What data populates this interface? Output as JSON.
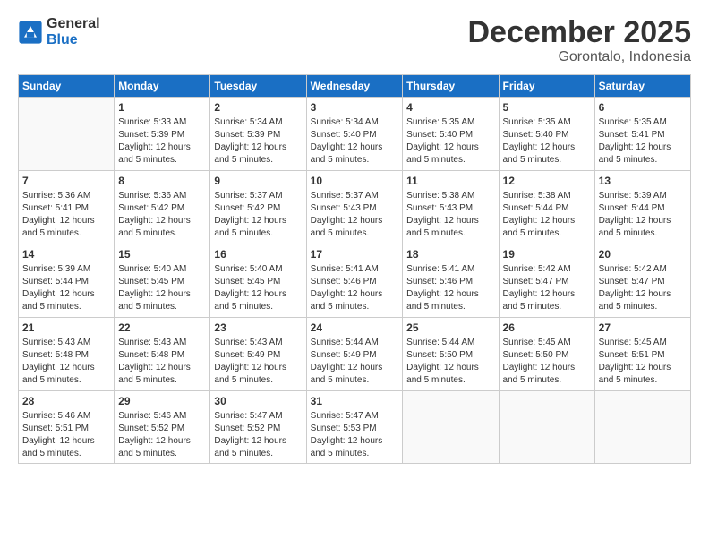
{
  "logo": {
    "text_general": "General",
    "text_blue": "Blue"
  },
  "title": "December 2025",
  "subtitle": "Gorontalo, Indonesia",
  "days_of_week": [
    "Sunday",
    "Monday",
    "Tuesday",
    "Wednesday",
    "Thursday",
    "Friday",
    "Saturday"
  ],
  "weeks": [
    [
      {
        "day": "",
        "info": ""
      },
      {
        "day": "1",
        "info": "Sunrise: 5:33 AM\nSunset: 5:39 PM\nDaylight: 12 hours\nand 5 minutes."
      },
      {
        "day": "2",
        "info": "Sunrise: 5:34 AM\nSunset: 5:39 PM\nDaylight: 12 hours\nand 5 minutes."
      },
      {
        "day": "3",
        "info": "Sunrise: 5:34 AM\nSunset: 5:40 PM\nDaylight: 12 hours\nand 5 minutes."
      },
      {
        "day": "4",
        "info": "Sunrise: 5:35 AM\nSunset: 5:40 PM\nDaylight: 12 hours\nand 5 minutes."
      },
      {
        "day": "5",
        "info": "Sunrise: 5:35 AM\nSunset: 5:40 PM\nDaylight: 12 hours\nand 5 minutes."
      },
      {
        "day": "6",
        "info": "Sunrise: 5:35 AM\nSunset: 5:41 PM\nDaylight: 12 hours\nand 5 minutes."
      }
    ],
    [
      {
        "day": "7",
        "info": "Sunrise: 5:36 AM\nSunset: 5:41 PM\nDaylight: 12 hours\nand 5 minutes."
      },
      {
        "day": "8",
        "info": "Sunrise: 5:36 AM\nSunset: 5:42 PM\nDaylight: 12 hours\nand 5 minutes."
      },
      {
        "day": "9",
        "info": "Sunrise: 5:37 AM\nSunset: 5:42 PM\nDaylight: 12 hours\nand 5 minutes."
      },
      {
        "day": "10",
        "info": "Sunrise: 5:37 AM\nSunset: 5:43 PM\nDaylight: 12 hours\nand 5 minutes."
      },
      {
        "day": "11",
        "info": "Sunrise: 5:38 AM\nSunset: 5:43 PM\nDaylight: 12 hours\nand 5 minutes."
      },
      {
        "day": "12",
        "info": "Sunrise: 5:38 AM\nSunset: 5:44 PM\nDaylight: 12 hours\nand 5 minutes."
      },
      {
        "day": "13",
        "info": "Sunrise: 5:39 AM\nSunset: 5:44 PM\nDaylight: 12 hours\nand 5 minutes."
      }
    ],
    [
      {
        "day": "14",
        "info": "Sunrise: 5:39 AM\nSunset: 5:44 PM\nDaylight: 12 hours\nand 5 minutes."
      },
      {
        "day": "15",
        "info": "Sunrise: 5:40 AM\nSunset: 5:45 PM\nDaylight: 12 hours\nand 5 minutes."
      },
      {
        "day": "16",
        "info": "Sunrise: 5:40 AM\nSunset: 5:45 PM\nDaylight: 12 hours\nand 5 minutes."
      },
      {
        "day": "17",
        "info": "Sunrise: 5:41 AM\nSunset: 5:46 PM\nDaylight: 12 hours\nand 5 minutes."
      },
      {
        "day": "18",
        "info": "Sunrise: 5:41 AM\nSunset: 5:46 PM\nDaylight: 12 hours\nand 5 minutes."
      },
      {
        "day": "19",
        "info": "Sunrise: 5:42 AM\nSunset: 5:47 PM\nDaylight: 12 hours\nand 5 minutes."
      },
      {
        "day": "20",
        "info": "Sunrise: 5:42 AM\nSunset: 5:47 PM\nDaylight: 12 hours\nand 5 minutes."
      }
    ],
    [
      {
        "day": "21",
        "info": "Sunrise: 5:43 AM\nSunset: 5:48 PM\nDaylight: 12 hours\nand 5 minutes."
      },
      {
        "day": "22",
        "info": "Sunrise: 5:43 AM\nSunset: 5:48 PM\nDaylight: 12 hours\nand 5 minutes."
      },
      {
        "day": "23",
        "info": "Sunrise: 5:43 AM\nSunset: 5:49 PM\nDaylight: 12 hours\nand 5 minutes."
      },
      {
        "day": "24",
        "info": "Sunrise: 5:44 AM\nSunset: 5:49 PM\nDaylight: 12 hours\nand 5 minutes."
      },
      {
        "day": "25",
        "info": "Sunrise: 5:44 AM\nSunset: 5:50 PM\nDaylight: 12 hours\nand 5 minutes."
      },
      {
        "day": "26",
        "info": "Sunrise: 5:45 AM\nSunset: 5:50 PM\nDaylight: 12 hours\nand 5 minutes."
      },
      {
        "day": "27",
        "info": "Sunrise: 5:45 AM\nSunset: 5:51 PM\nDaylight: 12 hours\nand 5 minutes."
      }
    ],
    [
      {
        "day": "28",
        "info": "Sunrise: 5:46 AM\nSunset: 5:51 PM\nDaylight: 12 hours\nand 5 minutes."
      },
      {
        "day": "29",
        "info": "Sunrise: 5:46 AM\nSunset: 5:52 PM\nDaylight: 12 hours\nand 5 minutes."
      },
      {
        "day": "30",
        "info": "Sunrise: 5:47 AM\nSunset: 5:52 PM\nDaylight: 12 hours\nand 5 minutes."
      },
      {
        "day": "31",
        "info": "Sunrise: 5:47 AM\nSunset: 5:53 PM\nDaylight: 12 hours\nand 5 minutes."
      },
      {
        "day": "",
        "info": ""
      },
      {
        "day": "",
        "info": ""
      },
      {
        "day": "",
        "info": ""
      }
    ]
  ]
}
